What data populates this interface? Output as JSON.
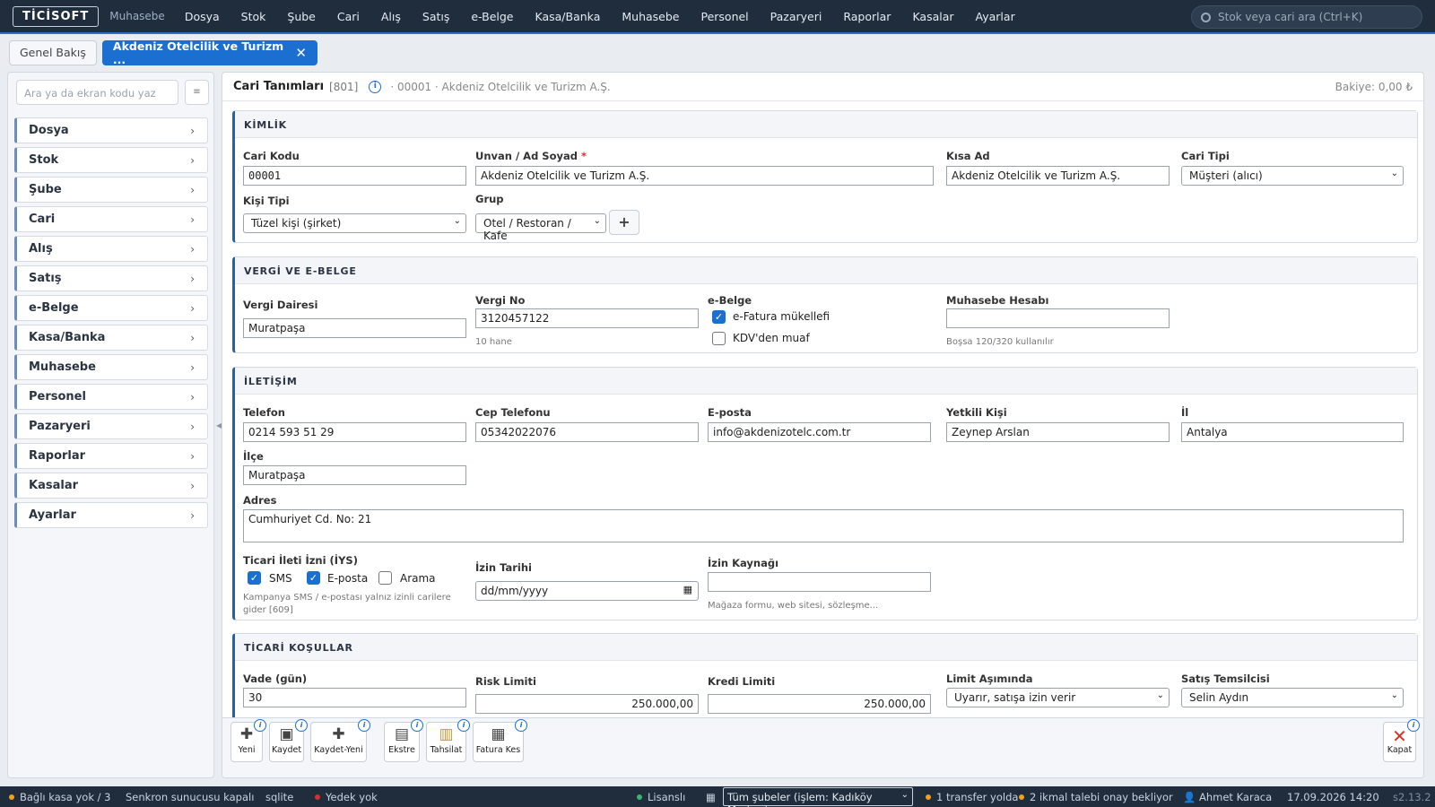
{
  "topbar": {
    "logo": "TİCİSOFT",
    "app_name": "Muhasebe",
    "menu": [
      "Dosya",
      "Stok",
      "Şube",
      "Cari",
      "Alış",
      "Satış",
      "e-Belge",
      "Kasa/Banka",
      "Muhasebe",
      "Personel",
      "Pazaryeri",
      "Raporlar",
      "Kasalar",
      "Ayarlar"
    ],
    "search_placeholder": "Stok veya cari ara (Ctrl+K)"
  },
  "tabs": [
    {
      "label": "Genel Bakış"
    },
    {
      "label": "Akdeniz Otelcilik ve Turizm ...",
      "close": "✕"
    }
  ],
  "sidebar": {
    "search_placeholder": "Ara ya da ekran kodu yaz",
    "btn": "≡",
    "items": [
      "Dosya",
      "Stok",
      "Şube",
      "Cari",
      "Alış",
      "Satış",
      "e-Belge",
      "Kasa/Banka",
      "Muhasebe",
      "Personel",
      "Pazaryeri",
      "Raporlar",
      "Kasalar",
      "Ayarlar"
    ],
    "chevron": "›"
  },
  "header": {
    "title": "Cari Tanımları",
    "code": "[801]",
    "info": "i",
    "subtitle": "· 00001 · Akdeniz Otelcilik ve Turizm A.Ş.",
    "balance": "Bakiye: 0,00 ₺"
  },
  "kimlik": {
    "title": "KİMLİK",
    "cari_kodu_label": "Cari Kodu",
    "cari_kodu": "00001",
    "unvan_label": "Unvan / Ad Soyad",
    "req": "*",
    "unvan": "Akdeniz Otelcilik ve Turizm A.Ş.",
    "kisa_ad_label": "Kısa Ad",
    "kisa_ad": "Akdeniz Otelcilik ve Turizm A.Ş.",
    "cari_tipi_label": "Cari Tipi",
    "cari_tipi": "Müşteri (alıcı)",
    "kisi_tipi_label": "Kişi Tipi",
    "kisi_tipi": "Tüzel kişi (şirket)",
    "grup_label": "Grup",
    "grup": "Otel / Restoran / Kafe",
    "add": "+"
  },
  "vergi": {
    "title": "VERGİ VE E-BELGE",
    "vergi_dairesi_label": "Vergi Dairesi",
    "vergi_dairesi": "Muratpaşa",
    "vergi_no_label": "Vergi No",
    "vergi_no": "3120457122",
    "vergi_no_hint": "10 hane",
    "ebelge_label": "e-Belge",
    "efatura": "e-Fatura mükellefi",
    "kdv": "KDV'den muaf",
    "muhasebe_label": "Muhasebe Hesabı",
    "muhasebe_hint": "Boşsa 120/320 kullanılır"
  },
  "iletisim": {
    "title": "İLETİŞİM",
    "telefon_label": "Telefon",
    "telefon": "0214 593 51 29",
    "cep_label": "Cep Telefonu",
    "cep": "05342022076",
    "eposta_label": "E-posta",
    "eposta": "info@akdenizotelc.com.tr",
    "yetkili_label": "Yetkili Kişi",
    "yetkili": "Zeynep Arslan",
    "il_label": "İl",
    "il": "Antalya",
    "ilce_label": "İlçe",
    "ilce": "Muratpaşa",
    "adres_label": "Adres",
    "adres": "Cumhuriyet Cd. No: 21",
    "iys_label": "Ticari İleti İzni (İYS)",
    "sms": "SMS",
    "eposta_cb": "E-posta",
    "arama": "Arama",
    "iys_hint": "Kampanya SMS / e-postası yalnız izinli carilere gider [609]",
    "izin_tarihi_label": "İzin Tarihi",
    "izin_tarihi": "dd/mm/yyyy",
    "izin_kaynagi_label": "İzin Kaynağı",
    "izin_kaynagi_hint": "Mağaza formu, web sitesi, sözleşme..."
  },
  "ticari": {
    "title": "TİCARİ KOŞULLAR",
    "vade_label": "Vade (gün)",
    "vade": "30",
    "risk_label": "Risk Limiti",
    "risk": "250.000,00",
    "kredi_label": "Kredi Limiti",
    "kredi": "250.000,00",
    "limit_label": "Limit Aşımında",
    "limit": "Uyarır, satışa izin verir",
    "temsilci_label": "Satış Temsilcisi",
    "temsilci": "Selin Aydın"
  },
  "toolbar": {
    "yeni": "Yeni",
    "kaydet": "Kaydet",
    "kaydet_yeni": "Kaydet-Yeni",
    "ekstre": "Ekstre",
    "tahsilat": "Tahsilat",
    "fatura_kes": "Fatura Kes",
    "kapat": "Kapat",
    "info": "i"
  },
  "statusbar": {
    "kasa": "Bağlı kasa yok / 3",
    "senkron": "Senkron sunucusu kapalı",
    "db": "sqlite",
    "yedek": "Yedek yok",
    "lisans": "Lisanslı",
    "sube": "Tüm şubeler (işlem: Kadıköy Merkez)",
    "transfer": "1 transfer yolda",
    "ikmal": "2 ikmal talebi onay bekliyor",
    "user": "Ahmet Karaca",
    "datetime": "17.09.2026 14:20",
    "version": "s2.13.2"
  },
  "colors": {
    "accent": "#1a6fd1",
    "topbar": "#1f2d3d",
    "danger": "#d9302c",
    "warn": "#f0a020",
    "ok": "#3cb371"
  }
}
